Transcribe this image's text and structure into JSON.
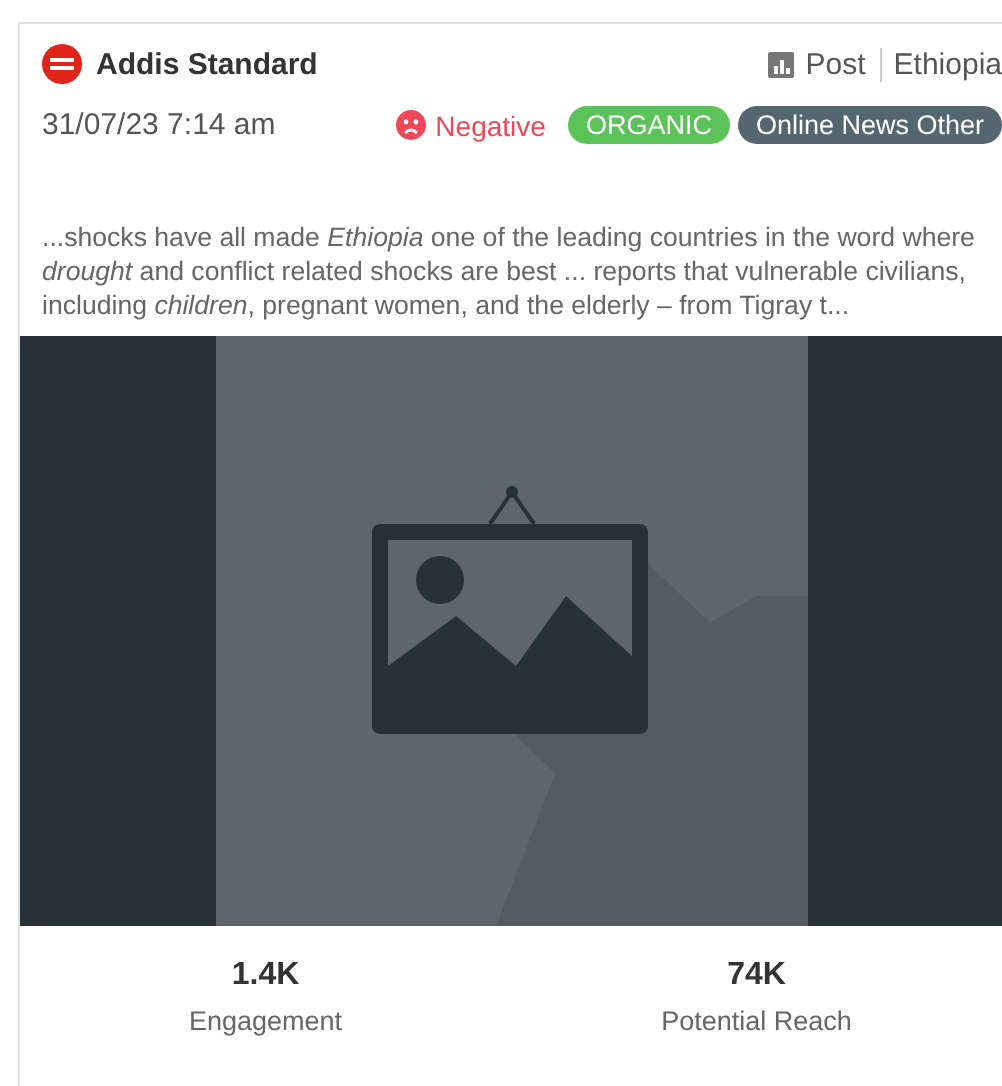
{
  "source": {
    "name": "Addis Standard",
    "type": "Post",
    "country": "Ethiopia"
  },
  "date": "31/07/23 7:14 am",
  "sentiment": {
    "kind": "negative",
    "label": "Negative"
  },
  "tags": [
    {
      "label": "ORGANIC",
      "color": "#5cc35a"
    },
    {
      "label": "Online News Other",
      "color": "#546670"
    }
  ],
  "excerpt": "...shocks have all made *Ethiopia* one of the leading countries in the word where *drought* and conflict related shocks are best ... reports that vulnerable civilians, including *children*, pregnant women, and the elderly – from Tigray t...",
  "stats": [
    {
      "value": "1.4K",
      "label": "Engagement"
    },
    {
      "value": "74K",
      "label": "Potential Reach"
    }
  ]
}
